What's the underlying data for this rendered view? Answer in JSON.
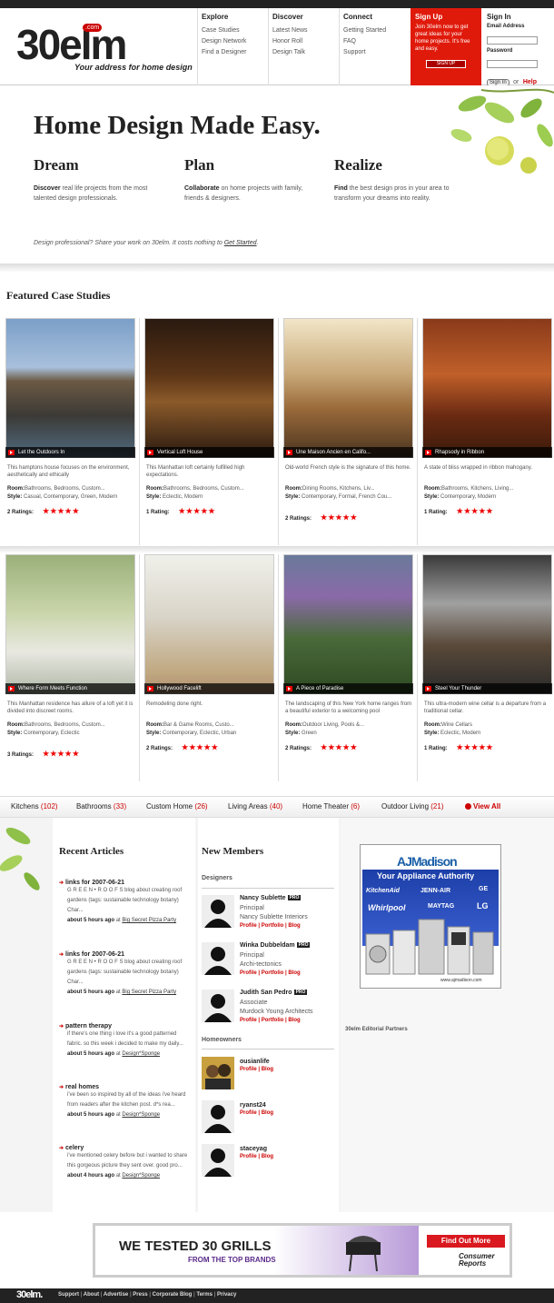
{
  "logo": {
    "word": "30elm",
    "com": ".com",
    "tagline": "Your address for home design"
  },
  "nav": [
    {
      "title": "Explore",
      "links": [
        "Case Studies",
        "Design Network",
        "Find a Designer"
      ]
    },
    {
      "title": "Discover",
      "links": [
        "Latest News",
        "Honor Roll",
        "Design Talk"
      ]
    },
    {
      "title": "Connect",
      "links": [
        "Getting Started",
        "FAQ",
        "Support"
      ]
    }
  ],
  "signup": {
    "title": "Sign Up",
    "text": "Join 30elm now to get great ideas for your home projects. It's free and easy.",
    "button": "SIGN UP"
  },
  "signin": {
    "title": "Sign In",
    "email_label": "Email Address",
    "password_label": "Password",
    "button": "Sign In",
    "or": "or",
    "help": "Help"
  },
  "hero": {
    "title": "Home Design Made Easy.",
    "pillars": [
      {
        "title": "Dream",
        "lead": "Discover",
        "text": " real life projects from the most talented design professionals."
      },
      {
        "title": "Plan",
        "lead": "Collaborate",
        "text": " on home projects with family, friends & designers."
      },
      {
        "title": "Realize",
        "lead": "Find",
        "text": " the best design pros in your area to transform your dreams into reality."
      }
    ],
    "note": "Design professional? Share your work on 30elm. It costs nothing to ",
    "note_link": "Get Started",
    "note_end": "."
  },
  "featured": {
    "title": "Featured Case Studies",
    "room_label": "Room:",
    "style_label": "Style:",
    "stars": "★★★★★",
    "cards": [
      {
        "caption": "Let the Outdoors In",
        "desc": "This hamptons house focuses on the environment, aesthetically and ethically",
        "room": "Bathrooms, Bedrooms, Custom...",
        "style": "Casual, Contemporary, Green, Modern",
        "ratings": "2 Ratings:"
      },
      {
        "caption": "Vertical Loft House",
        "desc": "This Manhattan loft certainly fulfilled high expectations.",
        "room": "Bathrooms, Bedrooms, Custom...",
        "style": "Eclectic, Modern",
        "ratings": "1 Rating:"
      },
      {
        "caption": "Une Maison Ancien en Califo...",
        "desc": "Old-world French style is the signature of this home.",
        "room": "Dining Rooms, Kitchens, Liv...",
        "style": "Contemporary, Formal, French Cou...",
        "ratings": "2 Ratings:"
      },
      {
        "caption": "Rhapsody in Ribbon",
        "desc": "A state of bliss wrapped in ribbon mahogany.",
        "room": "Bathrooms, Kitchens, Living...",
        "style": "Contemporary, Modern",
        "ratings": "1 Rating:"
      },
      {
        "caption": "Where Form Meets Function",
        "desc": "This Manhattan residence has allure of a loft yet it is divided into discreet rooms.",
        "room": "Bathrooms, Bedrooms, Custom...",
        "style": "Contemporary, Eclectic",
        "ratings": "3 Ratings:"
      },
      {
        "caption": "Hollywood Facelift",
        "desc": "Remodeling done right.",
        "room": "Bar & Game Rooms, Custo...",
        "style": "Contemporary, Eclectic, Urban",
        "ratings": "2 Ratings:"
      },
      {
        "caption": "A Piece of Paradise",
        "desc": "The landscaping of this New York home ranges from a beautiful exterior to a welcoming pool",
        "room": "Outdoor Living, Pools &...",
        "style": "Green",
        "ratings": "2 Ratings:"
      },
      {
        "caption": "Steel Your Thunder",
        "desc": "This ultra-modern wine cellar is a departure from a traditional cellar.",
        "room": "Wine Cellars",
        "style": "Eclectic, Modern",
        "ratings": "1 Rating:"
      }
    ]
  },
  "categories": [
    {
      "name": "Kitchens",
      "count": "(102)"
    },
    {
      "name": "Bathrooms",
      "count": "(33)"
    },
    {
      "name": "Custom Home",
      "count": "(26)"
    },
    {
      "name": "Living Areas",
      "count": "(40)"
    },
    {
      "name": "Home Theater",
      "count": "(6)"
    },
    {
      "name": "Outdoor Living",
      "count": "(21)"
    }
  ],
  "view_all": "View All",
  "articles": {
    "title": "Recent Articles",
    "at": "at",
    "items": [
      {
        "title": "links for 2007-06-21",
        "text": "G R E E N • R O O F S blog about creating roof gardens (tags: sustainable technology botany) Char...",
        "when": "about 5 hours ago",
        "source": "Big Secret Pizza Party"
      },
      {
        "title": "links for 2007-06-21",
        "text": "G R E E N • R O O F S blog about creating roof gardens (tags: sustainable technology botany) Char...",
        "when": "about 5 hours ago",
        "source": "Big Secret Pizza Party"
      },
      {
        "title": "pattern therapy",
        "text": "if there's one thing i love it's a good patterned fabric. so this week i decided to make my daily...",
        "when": "about 5 hours ago",
        "source": "Design*Sponge"
      },
      {
        "title": "real homes",
        "text": "i've been so inspired by all of the ideas i've heard from readers after the kitchen post. d*s rea...",
        "when": "about 5 hours ago",
        "source": "Design*Sponge"
      },
      {
        "title": "celery",
        "text": "i've mentioned celery before but i wanted to share this gorgeous picture they sent over. good pro...",
        "when": "about 4 hours ago",
        "source": "Design*Sponge"
      }
    ]
  },
  "members": {
    "title": "New Members",
    "designers_label": "Designers",
    "homeowners_label": "Homeowners",
    "pro": "PRO",
    "profile": "Profile",
    "portfolio": "Portfolio",
    "blog": "Blog",
    "sep": " | ",
    "designers": [
      {
        "name": "Nancy Sublette",
        "role": "Principal",
        "firm": "Nancy Sublette Interiors"
      },
      {
        "name": "Winka Dubbeldam",
        "role": "Principal",
        "firm": "Archi-tectonics"
      },
      {
        "name": "Judith San Pedro",
        "role": "Associate",
        "firm": "Murdock Young Architects"
      }
    ],
    "homeowners": [
      {
        "name": "ousianlife"
      },
      {
        "name": "ryanst24"
      },
      {
        "name": "staceyag"
      }
    ]
  },
  "ad_madison": {
    "brand": "AJMadison",
    "tag": "Your Appliance Authority",
    "brands": [
      "KitchenAid",
      "JENN-AIR",
      "GE",
      "Whirlpool",
      "MAYTAG",
      "LG"
    ],
    "url": "www.ajmadison.com"
  },
  "partners": "30elm Editorial Partners",
  "ad_grills": {
    "headline": "WE TESTED 30 GRILLS",
    "sub": "FROM THE TOP BRANDS",
    "cta": "Find Out More",
    "brand": "Consumer Reports"
  },
  "footer": {
    "logo": "30elm.",
    "links": [
      "Support",
      "About",
      "Advertise",
      "Press",
      "Corporate Blog",
      "Terms",
      "Privacy"
    ]
  },
  "colors": {
    "accent": "#e01a0b",
    "dark": "#222222"
  }
}
